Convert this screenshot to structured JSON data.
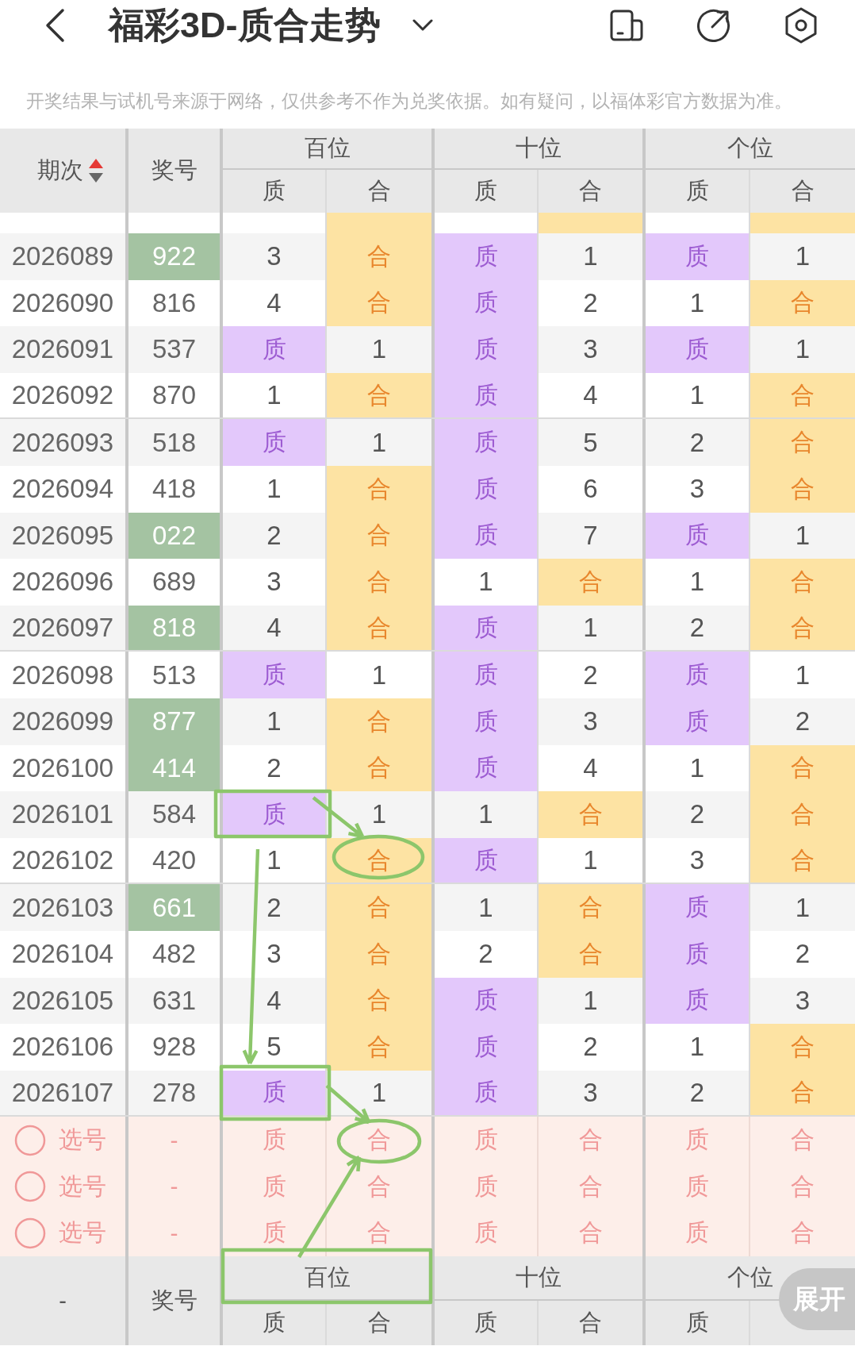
{
  "header": {
    "title": "福彩3D-质合走势"
  },
  "notice": "开奖结果与试机号来源于网络，仅供参考不作为兑奖依据。如有疑问，以福体彩官方数据为准。",
  "table": {
    "columns": [
      {
        "label": "期次",
        "sort_ascending": true
      },
      {
        "label": "奖号"
      }
    ],
    "groups": [
      {
        "label": "百位",
        "subcolumns": [
          "质",
          "合"
        ]
      },
      {
        "label": "十位",
        "subcolumns": [
          "质",
          "合"
        ]
      },
      {
        "label": "个位",
        "subcolumns": [
          "质",
          "合"
        ]
      }
    ],
    "cut_row": {
      "cells": [
        {
          "hit": false
        },
        {
          "hit": true
        },
        {
          "hit": false
        },
        {
          "hit": true
        },
        {
          "hit": false
        },
        {
          "hit": true
        }
      ]
    },
    "rows": [
      {
        "period": "2026089",
        "number": "922",
        "highlighted": true,
        "cells": [
          {
            "text": "3",
            "hit": false
          },
          {
            "text": "合",
            "hit": true
          },
          {
            "text": "质",
            "hit": true
          },
          {
            "text": "1",
            "hit": false
          },
          {
            "text": "质",
            "hit": true
          },
          {
            "text": "1",
            "hit": false
          }
        ]
      },
      {
        "period": "2026090",
        "number": "816",
        "highlighted": false,
        "cells": [
          {
            "text": "4",
            "hit": false
          },
          {
            "text": "合",
            "hit": true
          },
          {
            "text": "质",
            "hit": true
          },
          {
            "text": "2",
            "hit": false
          },
          {
            "text": "1",
            "hit": false
          },
          {
            "text": "合",
            "hit": true
          }
        ]
      },
      {
        "period": "2026091",
        "number": "537",
        "highlighted": false,
        "cells": [
          {
            "text": "质",
            "hit": true
          },
          {
            "text": "1",
            "hit": false
          },
          {
            "text": "质",
            "hit": true
          },
          {
            "text": "3",
            "hit": false
          },
          {
            "text": "质",
            "hit": true
          },
          {
            "text": "1",
            "hit": false
          }
        ]
      },
      {
        "period": "2026092",
        "number": "870",
        "highlighted": false,
        "cells": [
          {
            "text": "1",
            "hit": false
          },
          {
            "text": "合",
            "hit": true
          },
          {
            "text": "质",
            "hit": true
          },
          {
            "text": "4",
            "hit": false
          },
          {
            "text": "1",
            "hit": false
          },
          {
            "text": "合",
            "hit": true
          }
        ]
      },
      {
        "period": "2026093",
        "number": "518",
        "highlighted": false,
        "cells": [
          {
            "text": "质",
            "hit": true
          },
          {
            "text": "1",
            "hit": false
          },
          {
            "text": "质",
            "hit": true
          },
          {
            "text": "5",
            "hit": false
          },
          {
            "text": "2",
            "hit": false
          },
          {
            "text": "合",
            "hit": true
          }
        ]
      },
      {
        "period": "2026094",
        "number": "418",
        "highlighted": false,
        "cells": [
          {
            "text": "1",
            "hit": false
          },
          {
            "text": "合",
            "hit": true
          },
          {
            "text": "质",
            "hit": true
          },
          {
            "text": "6",
            "hit": false
          },
          {
            "text": "3",
            "hit": false
          },
          {
            "text": "合",
            "hit": true
          }
        ]
      },
      {
        "period": "2026095",
        "number": "022",
        "highlighted": true,
        "cells": [
          {
            "text": "2",
            "hit": false
          },
          {
            "text": "合",
            "hit": true
          },
          {
            "text": "质",
            "hit": true
          },
          {
            "text": "7",
            "hit": false
          },
          {
            "text": "质",
            "hit": true
          },
          {
            "text": "1",
            "hit": false
          }
        ]
      },
      {
        "period": "2026096",
        "number": "689",
        "highlighted": false,
        "cells": [
          {
            "text": "3",
            "hit": false
          },
          {
            "text": "合",
            "hit": true
          },
          {
            "text": "1",
            "hit": false
          },
          {
            "text": "合",
            "hit": true
          },
          {
            "text": "1",
            "hit": false
          },
          {
            "text": "合",
            "hit": true
          }
        ]
      },
      {
        "period": "2026097",
        "number": "818",
        "highlighted": true,
        "cells": [
          {
            "text": "4",
            "hit": false
          },
          {
            "text": "合",
            "hit": true
          },
          {
            "text": "质",
            "hit": true
          },
          {
            "text": "1",
            "hit": false
          },
          {
            "text": "2",
            "hit": false
          },
          {
            "text": "合",
            "hit": true
          }
        ]
      },
      {
        "period": "2026098",
        "number": "513",
        "highlighted": false,
        "cells": [
          {
            "text": "质",
            "hit": true
          },
          {
            "text": "1",
            "hit": false
          },
          {
            "text": "质",
            "hit": true
          },
          {
            "text": "2",
            "hit": false
          },
          {
            "text": "质",
            "hit": true
          },
          {
            "text": "1",
            "hit": false
          }
        ]
      },
      {
        "period": "2026099",
        "number": "877",
        "highlighted": true,
        "cells": [
          {
            "text": "1",
            "hit": false
          },
          {
            "text": "合",
            "hit": true
          },
          {
            "text": "质",
            "hit": true
          },
          {
            "text": "3",
            "hit": false
          },
          {
            "text": "质",
            "hit": true
          },
          {
            "text": "2",
            "hit": false
          }
        ]
      },
      {
        "period": "2026100",
        "number": "414",
        "highlighted": true,
        "cells": [
          {
            "text": "2",
            "hit": false
          },
          {
            "text": "合",
            "hit": true
          },
          {
            "text": "质",
            "hit": true
          },
          {
            "text": "4",
            "hit": false
          },
          {
            "text": "1",
            "hit": false
          },
          {
            "text": "合",
            "hit": true
          }
        ]
      },
      {
        "period": "2026101",
        "number": "584",
        "highlighted": false,
        "cells": [
          {
            "text": "质",
            "hit": true
          },
          {
            "text": "1",
            "hit": false
          },
          {
            "text": "1",
            "hit": false
          },
          {
            "text": "合",
            "hit": true
          },
          {
            "text": "2",
            "hit": false
          },
          {
            "text": "合",
            "hit": true
          }
        ]
      },
      {
        "period": "2026102",
        "number": "420",
        "highlighted": false,
        "cells": [
          {
            "text": "1",
            "hit": false
          },
          {
            "text": "合",
            "hit": true
          },
          {
            "text": "质",
            "hit": true
          },
          {
            "text": "1",
            "hit": false
          },
          {
            "text": "3",
            "hit": false
          },
          {
            "text": "合",
            "hit": true
          }
        ]
      },
      {
        "period": "2026103",
        "number": "661",
        "highlighted": true,
        "cells": [
          {
            "text": "2",
            "hit": false
          },
          {
            "text": "合",
            "hit": true
          },
          {
            "text": "1",
            "hit": false
          },
          {
            "text": "合",
            "hit": true
          },
          {
            "text": "质",
            "hit": true
          },
          {
            "text": "1",
            "hit": false
          }
        ]
      },
      {
        "period": "2026104",
        "number": "482",
        "highlighted": false,
        "cells": [
          {
            "text": "3",
            "hit": false
          },
          {
            "text": "合",
            "hit": true
          },
          {
            "text": "2",
            "hit": false
          },
          {
            "text": "合",
            "hit": true
          },
          {
            "text": "质",
            "hit": true
          },
          {
            "text": "2",
            "hit": false
          }
        ]
      },
      {
        "period": "2026105",
        "number": "631",
        "highlighted": false,
        "cells": [
          {
            "text": "4",
            "hit": false
          },
          {
            "text": "合",
            "hit": true
          },
          {
            "text": "质",
            "hit": true
          },
          {
            "text": "1",
            "hit": false
          },
          {
            "text": "质",
            "hit": true
          },
          {
            "text": "3",
            "hit": false
          }
        ]
      },
      {
        "period": "2026106",
        "number": "928",
        "highlighted": false,
        "cells": [
          {
            "text": "5",
            "hit": false
          },
          {
            "text": "合",
            "hit": true
          },
          {
            "text": "质",
            "hit": true
          },
          {
            "text": "2",
            "hit": false
          },
          {
            "text": "1",
            "hit": false
          },
          {
            "text": "合",
            "hit": true
          }
        ]
      },
      {
        "period": "2026107",
        "number": "278",
        "highlighted": false,
        "cells": [
          {
            "text": "质",
            "hit": true
          },
          {
            "text": "1",
            "hit": false
          },
          {
            "text": "质",
            "hit": true
          },
          {
            "text": "3",
            "hit": false
          },
          {
            "text": "2",
            "hit": false
          },
          {
            "text": "合",
            "hit": true
          }
        ]
      }
    ],
    "pick_rows": [
      {
        "selected": false,
        "label": "选号",
        "number": "-",
        "options": [
          {
            "text": "质",
            "selected": false
          },
          {
            "text": "合",
            "selected": false
          },
          {
            "text": "质",
            "selected": false
          },
          {
            "text": "合",
            "selected": false
          },
          {
            "text": "质",
            "selected": false
          },
          {
            "text": "合",
            "selected": false
          }
        ]
      },
      {
        "selected": false,
        "label": "选号",
        "number": "-",
        "options": [
          {
            "text": "质",
            "selected": false
          },
          {
            "text": "合",
            "selected": false
          },
          {
            "text": "质",
            "selected": false
          },
          {
            "text": "合",
            "selected": false
          },
          {
            "text": "质",
            "selected": false
          },
          {
            "text": "合",
            "selected": false
          }
        ]
      },
      {
        "selected": false,
        "label": "选号",
        "number": "-",
        "options": [
          {
            "text": "质",
            "selected": false
          },
          {
            "text": "合",
            "selected": false
          },
          {
            "text": "质",
            "selected": false
          },
          {
            "text": "合",
            "selected": false
          },
          {
            "text": "质",
            "selected": false
          },
          {
            "text": "合",
            "selected": false
          }
        ]
      }
    ],
    "footer": {
      "period": "-",
      "number": "奖号",
      "groups": [
        {
          "label": "百位",
          "subcolumns": [
            "质",
            "合"
          ]
        },
        {
          "label": "十位",
          "subcolumns": [
            "质",
            "合"
          ]
        },
        {
          "label": "个位",
          "subcolumns": [
            "质"
          ]
        }
      ]
    }
  },
  "expand_button": {
    "label": "展开"
  }
}
